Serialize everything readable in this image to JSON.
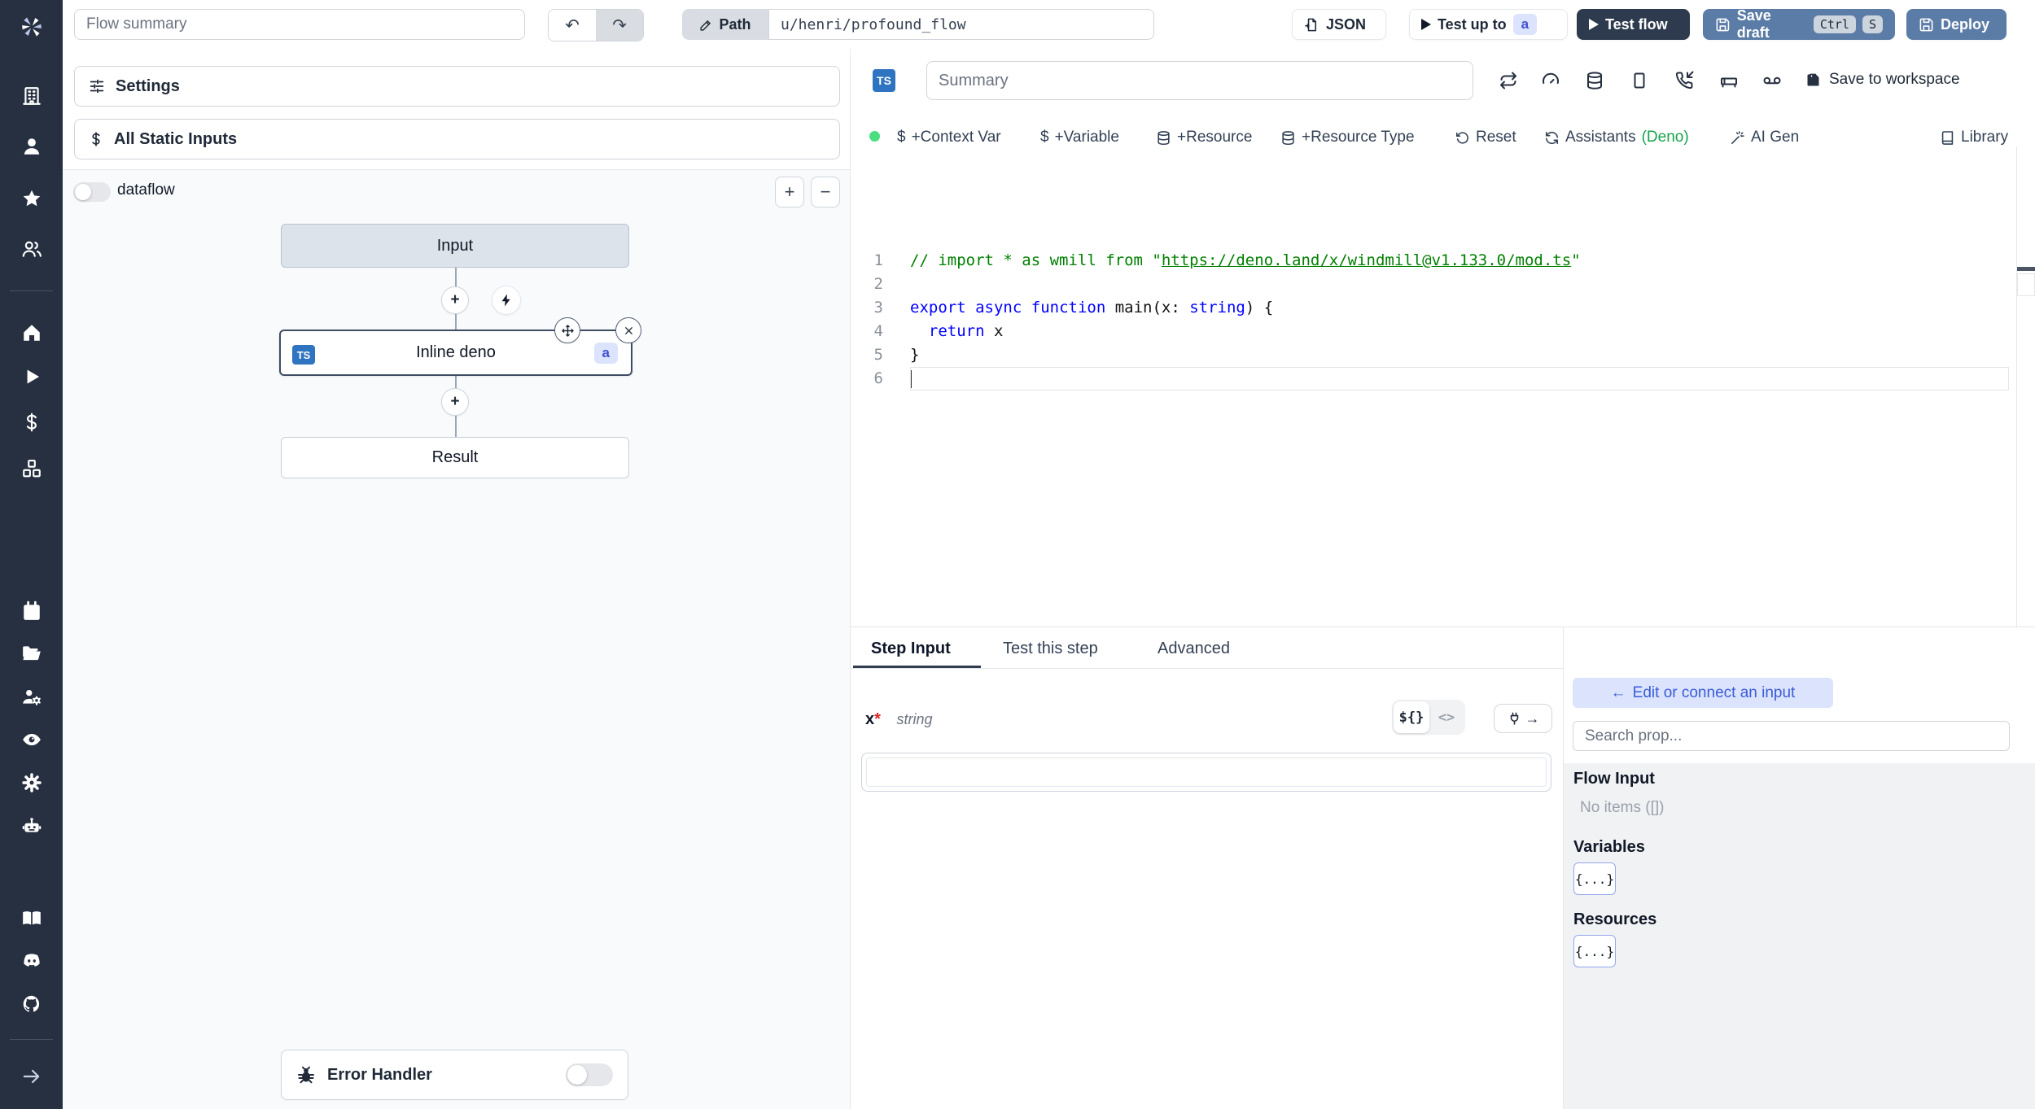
{
  "topbar": {
    "flow_summary_placeholder": "Flow summary",
    "path_label": "Path",
    "path_value": "u/henri/profound_flow",
    "json_label": "JSON",
    "test_up_to_label": "Test up to",
    "test_up_to_badge": "a",
    "test_flow_label": "Test flow",
    "save_draft_label": "Save draft",
    "kbd_ctrl": "Ctrl",
    "kbd_s": "S",
    "deploy_label": "Deploy"
  },
  "sidebar": {
    "icons": [
      "windmill-logo",
      "building",
      "user",
      "star",
      "users",
      "home",
      "play",
      "dollar-sign",
      "boxes",
      "calendar",
      "folder-open",
      "users-cog",
      "eye",
      "settings-gear",
      "robot",
      "book-open",
      "discord",
      "github",
      "arrow-right"
    ]
  },
  "flow_panel": {
    "settings_label": "Settings",
    "all_static_inputs_label": "All Static Inputs",
    "dataflow_label": "dataflow",
    "zoom_in_label": "+",
    "zoom_out_label": "−",
    "nodes": {
      "input_label": "Input",
      "step_label": "Inline deno",
      "step_lang_badge": "TS",
      "step_id_badge": "a",
      "result_label": "Result"
    },
    "error_handler_label": "Error Handler"
  },
  "editor": {
    "lang_badge": "TS",
    "summary_placeholder": "Summary",
    "header_icons": [
      "repeat",
      "gauge",
      "database",
      "rectangle",
      "phone-incoming",
      "bed",
      "voicemail"
    ],
    "save_to_workspace_label": "Save to workspace",
    "toolbar": {
      "context_var": "+Context Var",
      "variable": "+Variable",
      "resource": "+Resource",
      "resource_type": "+Resource Type",
      "reset": "Reset",
      "assistants": "Assistants",
      "assistants_lang": "(Deno)",
      "ai_gen": "AI Gen",
      "library": "Library",
      "dollar": "$"
    },
    "code": {
      "lines": [
        {
          "tokens": [
            {
              "t": "// import * as wmill from \"",
              "c": "cmt"
            },
            {
              "t": "https://deno.land/x/windmill@v1.133.0/mod.ts",
              "c": "cmt u"
            },
            {
              "t": "\"",
              "c": "cmt"
            }
          ]
        },
        {
          "tokens": []
        },
        {
          "tokens": [
            {
              "t": "export",
              "c": "kw"
            },
            {
              "t": " ",
              "c": "pl"
            },
            {
              "t": "async",
              "c": "kw"
            },
            {
              "t": " ",
              "c": "pl"
            },
            {
              "t": "function",
              "c": "kw"
            },
            {
              "t": " main(x: ",
              "c": "pl"
            },
            {
              "t": "string",
              "c": "kw"
            },
            {
              "t": ") {",
              "c": "pl"
            }
          ]
        },
        {
          "tokens": [
            {
              "t": "  ",
              "c": "pl"
            },
            {
              "t": "return",
              "c": "kw"
            },
            {
              "t": " x",
              "c": "pl"
            }
          ]
        },
        {
          "tokens": [
            {
              "t": "}",
              "c": "pl"
            }
          ]
        },
        {
          "tokens": [],
          "cursor": true,
          "current": true
        }
      ]
    }
  },
  "step_panel": {
    "tabs": [
      "Step Input",
      "Test this step",
      "Advanced"
    ],
    "active_tab": "Step Input",
    "field_name": "x",
    "required_mark": "*",
    "field_type": "string",
    "toggle_expr": "${}",
    "toggle_code": "<>",
    "arrow_right": "→",
    "input_value": ""
  },
  "connect_panel": {
    "back_arrow": "←",
    "back_button_label": "Edit or connect an input",
    "search_placeholder": "Search prop...",
    "flow_input_title": "Flow Input",
    "flow_input_empty": "No items ([])",
    "variables_title": "Variables",
    "variables_chip": "{...}",
    "resources_title": "Resources",
    "resources_chip": "{...}"
  },
  "colors": {
    "sidebar_bg": "#273041",
    "primary_button": "#5b7ca6",
    "dark_button": "#2e3a4e",
    "accent_badge_bg": "#dbe3fd",
    "accent_badge_text": "#4150d0",
    "ts_badge": "#2f74c0",
    "status_dot": "#4ade80",
    "deno_green": "#16a34a",
    "code_comment": "#008000",
    "code_keyword": "#0000ff"
  }
}
